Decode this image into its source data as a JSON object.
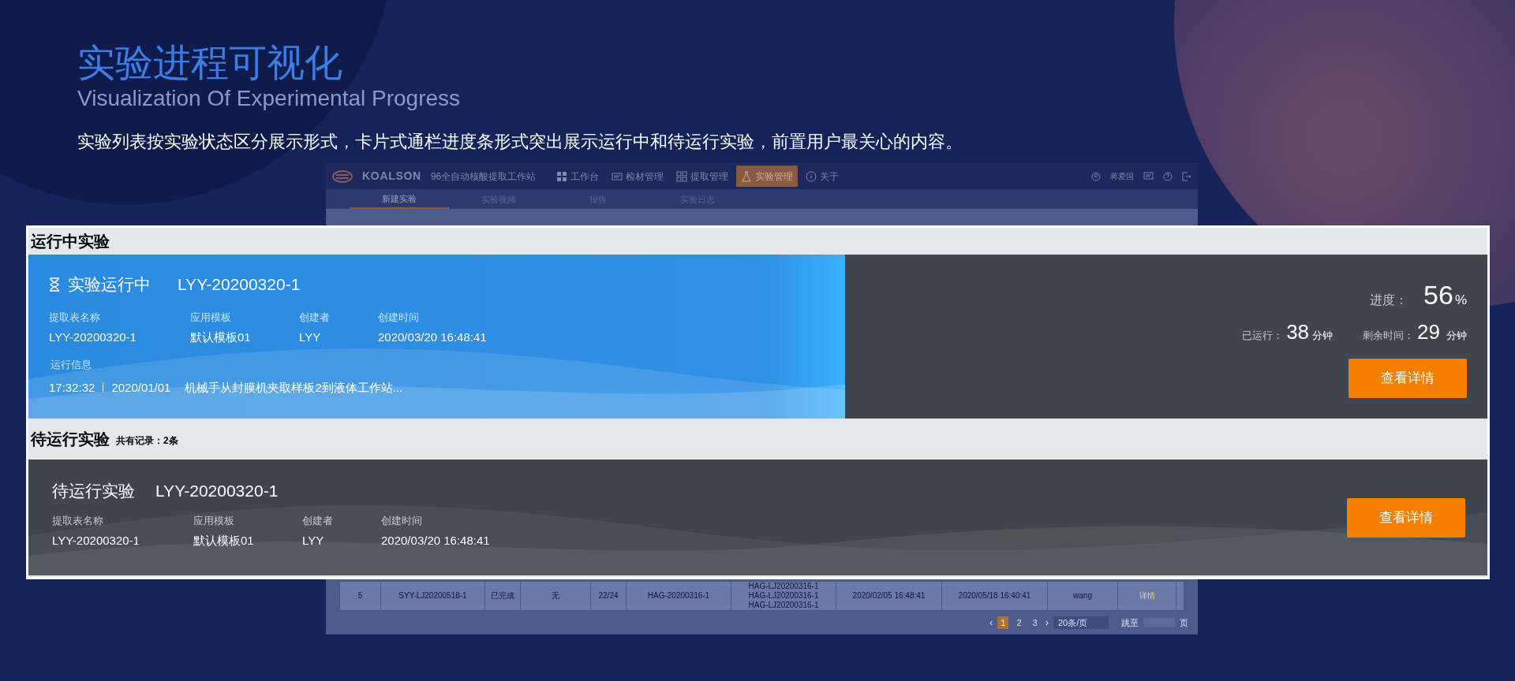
{
  "heading": {
    "title": "实验进程可视化",
    "subtitle": "Visualization Of Experimental Progress",
    "description": "实验列表按实验状态区分展示形式，卡片式通栏进度条形式突出展示运行中和待运行实验，前置用户最关心的内容。"
  },
  "app": {
    "logo": "KOALSON",
    "product": "96全自动核酸提取工作站",
    "nav": [
      {
        "label": "工作台",
        "selected": false
      },
      {
        "label": "检材管理",
        "selected": false
      },
      {
        "label": "提取管理",
        "selected": false
      },
      {
        "label": "实验管理",
        "selected": true
      },
      {
        "label": "关于",
        "selected": false
      }
    ],
    "user": "蒋爱国",
    "subtabs": [
      {
        "label": "新建实验",
        "selected": true
      },
      {
        "label": "实验视频",
        "selected": false
      },
      {
        "label": "报告",
        "selected": false
      },
      {
        "label": "实验日志",
        "selected": false
      }
    ],
    "table_row": [
      [
        "5"
      ],
      [
        "SYY-LJ20200518-1"
      ],
      [
        "已完成"
      ],
      [
        "无"
      ],
      [
        "22/24"
      ],
      [
        "HAG-20200316-1"
      ],
      [
        "HAG-LJ20200316-1",
        "HAG-LJ20200316-1",
        "HAG-LJ20200316-1"
      ],
      [
        "2020/02/05 16:48:41"
      ],
      [
        "2020/05/18 16:40:41"
      ],
      [
        "wang"
      ],
      [
        "详情"
      ]
    ],
    "pagination": {
      "prev": "‹",
      "next": "›",
      "pages": [
        {
          "label": "1",
          "selected": true
        },
        {
          "label": "2",
          "selected": false
        },
        {
          "label": "3",
          "selected": false
        }
      ],
      "page_size": "20条/页",
      "jump": "跳至",
      "page_unit": "页"
    }
  },
  "running": {
    "section_title": "运行中实验",
    "status": "实验运行中",
    "experiment_id": "LYY-20200320-1",
    "fields": [
      {
        "label": "提取表名称",
        "value": "LYY-20200320-1"
      },
      {
        "label": "应用模板",
        "value": "默认模板01"
      },
      {
        "label": "创建者",
        "value": "LYY"
      },
      {
        "label": "创建时间",
        "value": "2020/03/20 16:48:41"
      }
    ],
    "info_label": "运行信息",
    "info_time": "17:32:32",
    "info_date": "2020/01/01",
    "info_message": "机械手从封膜机夹取样板2到液体工作站...",
    "level": 0.56,
    "progress_label": "进度：",
    "progress_value": "56",
    "progress_unit": "%",
    "elapsed_label": "已运行：",
    "elapsed": "38",
    "elapsed_unit": "分钟",
    "remaining_label": "剩余时间：",
    "remaining": "29",
    "remaining_unit": "分钟",
    "button": "查看详情"
  },
  "pending": {
    "section_title": "待运行实验",
    "count": "共有记录：2条",
    "cards": [
      {
        "title": "待运行实验",
        "experiment_id": "LYY-20200320-1",
        "fields": [
          {
            "label": "提取表名称",
            "value": "LYY-20200320-1"
          },
          {
            "label": "应用模板",
            "value": "默认模板01"
          },
          {
            "label": "创建者",
            "value": "LYY"
          },
          {
            "label": "创建时间",
            "value": "2020/03/20 16:48:41"
          }
        ],
        "button": "查看详情"
      }
    ]
  }
}
